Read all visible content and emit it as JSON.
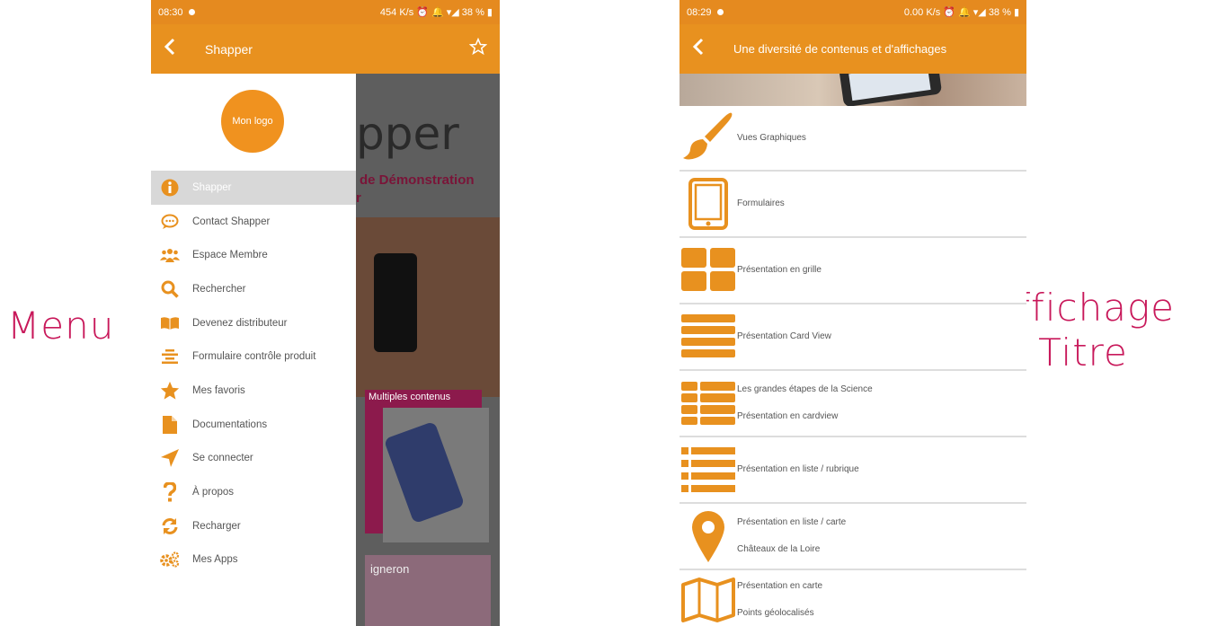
{
  "captions": {
    "menu": "Menu",
    "affichage_line1": "Affichage",
    "affichage_line2": "Titre"
  },
  "colors": {
    "accent": "#e8911f",
    "caption": "#c8185a"
  },
  "phone1": {
    "status": {
      "time": "08:30",
      "right": "454 K/s ⏰ 🔔 ▾◢ 38 % ▮"
    },
    "appbar": {
      "title": "Shapper",
      "back_icon": "chevron-left-icon",
      "action_icon": "star-outline-icon"
    },
    "logo_text": "Mon logo",
    "background": {
      "brand": "pper",
      "headline": "de Démonstration",
      "headline2": "r",
      "band_label": "Multiples contenus",
      "band2_label": "igneron"
    },
    "menu": [
      {
        "label": "Shapper",
        "icon": "info-icon",
        "active": true
      },
      {
        "label": "Contact Shapper",
        "icon": "chat-bubble-icon",
        "active": false
      },
      {
        "label": "Espace Membre",
        "icon": "users-icon",
        "active": false
      },
      {
        "label": "Rechercher",
        "icon": "search-icon",
        "active": false
      },
      {
        "label": "Devenez distributeur",
        "icon": "book-icon",
        "active": false
      },
      {
        "label": "Formulaire contrôle produit",
        "icon": "align-center-icon",
        "active": false
      },
      {
        "label": "Mes favoris",
        "icon": "star-icon",
        "active": false
      },
      {
        "label": "Documentations",
        "icon": "file-icon",
        "active": false
      },
      {
        "label": "Se connecter",
        "icon": "location-arrow-icon",
        "active": false
      },
      {
        "label": "À propos",
        "icon": "question-icon",
        "active": false
      },
      {
        "label": "Recharger",
        "icon": "refresh-icon",
        "active": false
      },
      {
        "label": "Mes Apps",
        "icon": "gears-icon",
        "active": false
      }
    ]
  },
  "phone2": {
    "status": {
      "time": "08:29",
      "right": "0.00 K/s ⏰ 🔔 ▾◢ 38 % ▮"
    },
    "appbar": {
      "title": "Une diversité de contenus et d'affichages",
      "back_icon": "chevron-left-icon"
    },
    "items": [
      {
        "icon": "paint-brush-icon",
        "lines": [
          "Vues Graphiques"
        ]
      },
      {
        "icon": "tablet-icon",
        "lines": [
          "Formulaires"
        ]
      },
      {
        "icon": "grid-icon",
        "lines": [
          "Présentation en grille"
        ]
      },
      {
        "icon": "card-view-icon",
        "lines": [
          "Présentation Card View"
        ]
      },
      {
        "icon": "card-list-icon",
        "lines": [
          "Les grandes étapes de la Science",
          "Présentation en cardview"
        ]
      },
      {
        "icon": "list-icon",
        "lines": [
          "Présentation en liste / rubrique"
        ]
      },
      {
        "icon": "map-marker-icon",
        "lines": [
          "Présentation en liste / carte",
          "Châteaux de la Loire"
        ]
      },
      {
        "icon": "map-icon",
        "lines": [
          "Présentation en carte",
          "Points géolocalisés"
        ]
      }
    ]
  }
}
